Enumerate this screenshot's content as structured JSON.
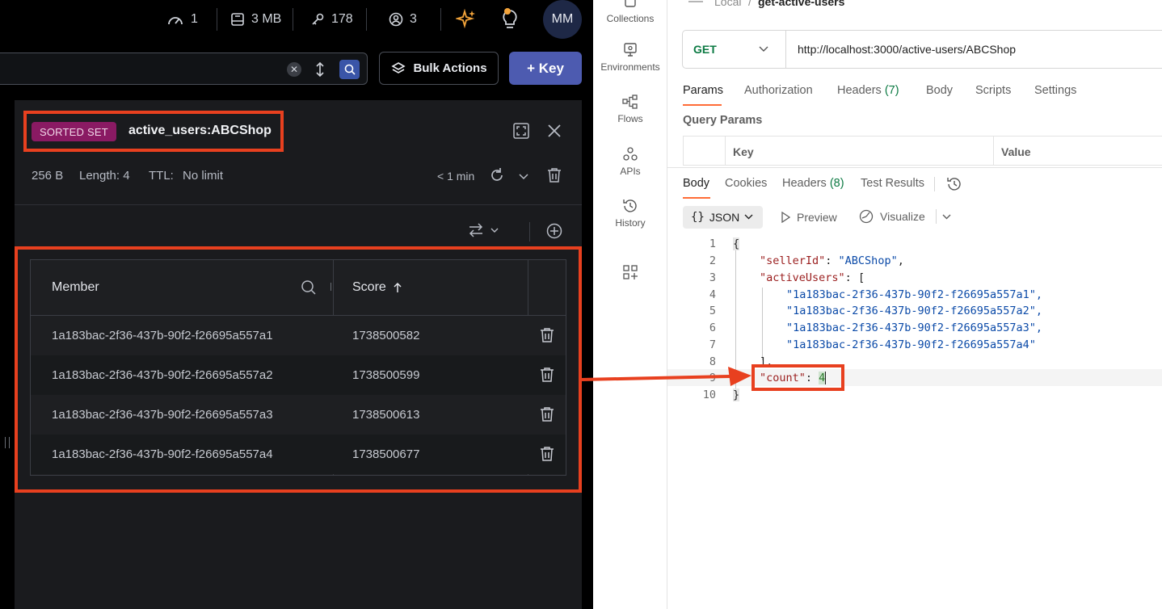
{
  "redis": {
    "stats": {
      "ops": "1",
      "memory": "3 MB",
      "keys": "178",
      "clients": "3"
    },
    "avatar": "MM",
    "toolbar": {
      "bulk_label": "Bulk Actions",
      "add_key_label": "+ Key"
    },
    "key": {
      "type": "SORTED SET",
      "name": "active_users:ABCShop",
      "size": "256 B",
      "length": "Length: 4",
      "ttl_label": "TTL:",
      "ttl_value": "No limit",
      "refresh": "< 1 min"
    },
    "table": {
      "headers": {
        "member": "Member",
        "score": "Score"
      },
      "rows": [
        {
          "member": "1a183bac-2f36-437b-90f2-f26695a557a1",
          "score": "1738500582"
        },
        {
          "member": "1a183bac-2f36-437b-90f2-f26695a557a2",
          "score": "1738500599"
        },
        {
          "member": "1a183bac-2f36-437b-90f2-f26695a557a3",
          "score": "1738500613"
        },
        {
          "member": "1a183bac-2f36-437b-90f2-f26695a557a4",
          "score": "1738500677"
        }
      ]
    }
  },
  "postman": {
    "rail": [
      "Collections",
      "Environments",
      "Flows",
      "APIs",
      "History"
    ],
    "breadcrumb": {
      "workspace": "Local",
      "sep": "/",
      "request": "get-active-users"
    },
    "method": "GET",
    "url": "http://localhost:3000/active-users/ABCShop",
    "request_tabs": {
      "params": "Params",
      "auth": "Authorization",
      "headers": "Headers",
      "headers_count": "(7)",
      "body": "Body",
      "scripts": "Scripts",
      "settings": "Settings"
    },
    "query_params": {
      "title": "Query Params",
      "key_header": "Key",
      "value_header": "Value"
    },
    "response_tabs": {
      "body": "Body",
      "cookies": "Cookies",
      "headers": "Headers",
      "headers_count": "(8)",
      "tests": "Test Results"
    },
    "format": {
      "json": "JSON",
      "preview": "Preview",
      "visualize": "Visualize"
    },
    "code": {
      "line_numbers": [
        "1",
        "2",
        "3",
        "4",
        "5",
        "6",
        "7",
        "8",
        "9",
        "10"
      ],
      "open_brace": "{",
      "seller_key": "\"sellerId\"",
      "seller_val": "\"ABCShop\"",
      "active_key": "\"activeUsers\"",
      "open_bracket": "[",
      "users": [
        "\"1a183bac-2f36-437b-90f2-f26695a557a1\"",
        "\"1a183bac-2f36-437b-90f2-f26695a557a2\"",
        "\"1a183bac-2f36-437b-90f2-f26695a557a3\"",
        "\"1a183bac-2f36-437b-90f2-f26695a557a4\""
      ],
      "close_bracket": "],",
      "count_key": "\"count\"",
      "count_val": "4",
      "close_brace": "}"
    }
  },
  "colors": {
    "accent_red": "#e8401f",
    "badge": "#8a1a63",
    "key_button": "#4d5bb0",
    "postman_accent": "#ff6c37"
  }
}
